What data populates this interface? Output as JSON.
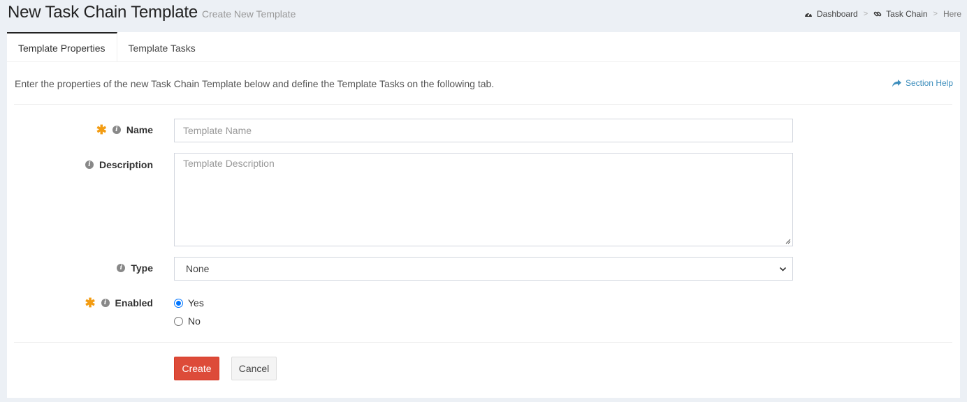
{
  "header": {
    "title": "New Task Chain Template",
    "subtitle": "Create New Template"
  },
  "breadcrumb": {
    "items": [
      {
        "label": "Dashboard",
        "icon": "dashboard-icon"
      },
      {
        "label": "Task Chain",
        "icon": "link-icon"
      },
      {
        "label": "Here"
      }
    ],
    "separator": ">"
  },
  "tabs": [
    {
      "label": "Template Properties",
      "active": true
    },
    {
      "label": "Template Tasks",
      "active": false
    }
  ],
  "intro_text": "Enter the properties of the new Task Chain Template below and define the Template Tasks on the following tab.",
  "section_help": {
    "label": "Section Help",
    "icon": "share-icon"
  },
  "form": {
    "name": {
      "label": "Name",
      "required": true,
      "placeholder": "Template Name",
      "value": ""
    },
    "description": {
      "label": "Description",
      "required": false,
      "placeholder": "Template Description",
      "value": ""
    },
    "type": {
      "label": "Type",
      "selected": "None"
    },
    "enabled": {
      "label": "Enabled",
      "required": true,
      "options": [
        {
          "label": "Yes",
          "checked": true
        },
        {
          "label": "No",
          "checked": false
        }
      ]
    }
  },
  "buttons": {
    "create": "Create",
    "cancel": "Cancel"
  },
  "colors": {
    "accent": "#3c8dbc",
    "danger": "#dd4b39",
    "required": "#f39c12",
    "radio": "#0075ff"
  }
}
